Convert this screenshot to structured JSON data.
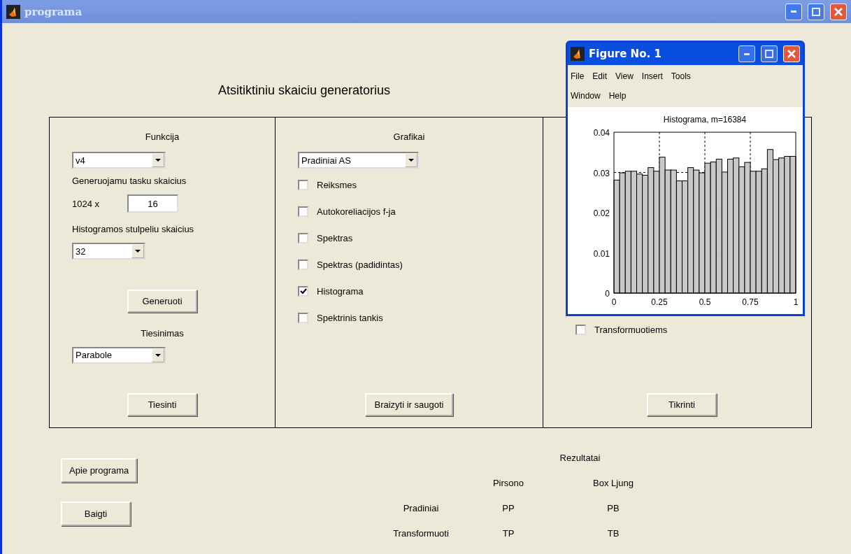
{
  "window": {
    "title": "programa"
  },
  "heading": "Atsitiktiniu skaiciu generatorius",
  "panels": [
    {
      "title": "Funkcija",
      "items": [
        {
          "kind": "dropdown",
          "value": "v4"
        },
        {
          "kind": "label",
          "text": "Generuojamu tasku skaicius"
        },
        {
          "kind": "multiplier",
          "text": "1024 x",
          "value": "16"
        },
        {
          "kind": "label",
          "text": "Histogramos stulpeliu skaicius"
        },
        {
          "kind": "dropdown",
          "value": "32"
        },
        {
          "kind": "button",
          "text": "Generuoti"
        },
        {
          "kind": "heading",
          "text": "Tiesinimas"
        },
        {
          "kind": "dropdown",
          "value": "Parabole"
        },
        {
          "kind": "button",
          "text": "Tiesinti"
        }
      ]
    },
    {
      "title": "Grafikai",
      "items": [
        {
          "kind": "dropdown",
          "value": "Pradiniai AS"
        },
        {
          "kind": "checkbox",
          "text": "Reiksmes",
          "checked": false
        },
        {
          "kind": "checkbox",
          "text": "Autokoreliacijos f-ja",
          "checked": false
        },
        {
          "kind": "checkbox",
          "text": "Spektras",
          "checked": false
        },
        {
          "kind": "checkbox",
          "text": "Spektras (padidintas)",
          "checked": false
        },
        {
          "kind": "checkbox",
          "text": "Histograma",
          "checked": true
        },
        {
          "kind": "checkbox",
          "text": "Spektrinis tankis",
          "checked": false
        },
        {
          "kind": "button",
          "text": "Braizyti ir saugoti"
        }
      ]
    },
    {
      "items": [
        {
          "kind": "checkbox",
          "text": "Transformuotiems",
          "checked": false
        },
        {
          "kind": "button",
          "text": "Tikrinti"
        }
      ]
    }
  ],
  "side_buttons": [
    "Apie programa",
    "Baigti"
  ],
  "results": {
    "title": "Rezultatai",
    "columns": [
      "Pirsono",
      "Box Ljung"
    ],
    "rows": [
      {
        "label": "Pradiniai",
        "cells": [
          "PP",
          "PB"
        ]
      },
      {
        "label": "Transformuoti",
        "cells": [
          "TP",
          "TB"
        ]
      }
    ]
  },
  "figure": {
    "title": "Figure No. 1",
    "menu": [
      [
        "File",
        "Edit",
        "View",
        "Insert",
        "Tools"
      ],
      [
        "Window",
        "Help"
      ]
    ],
    "chart_data": {
      "type": "bar",
      "title": "Histograma, m=16384",
      "xlim": [
        0,
        1
      ],
      "ylim": [
        0,
        0.04
      ],
      "xticks": [
        0,
        0.25,
        0.5,
        0.75,
        1
      ],
      "yticks": [
        0,
        0.01,
        0.02,
        0.03,
        0.04
      ],
      "grid": true,
      "x": [
        0.015625,
        0.046875,
        0.078125,
        0.109375,
        0.140625,
        0.171875,
        0.203125,
        0.234375,
        0.265625,
        0.296875,
        0.328125,
        0.359375,
        0.390625,
        0.421875,
        0.453125,
        0.484375,
        0.515625,
        0.546875,
        0.578125,
        0.609375,
        0.640625,
        0.671875,
        0.703125,
        0.734375,
        0.765625,
        0.796875,
        0.828125,
        0.859375,
        0.890625,
        0.921875,
        0.953125,
        0.984375
      ],
      "series": [
        {
          "color": "#c8c8c8",
          "values": [
            0.0281,
            0.0299,
            0.0303,
            0.0303,
            0.0296,
            0.0293,
            0.0312,
            0.0303,
            0.0338,
            0.0306,
            0.0306,
            0.0279,
            0.0279,
            0.0312,
            0.0306,
            0.0299,
            0.0323,
            0.0326,
            0.0333,
            0.0301,
            0.0333,
            0.0336,
            0.0314,
            0.0325,
            0.0303,
            0.0303,
            0.0309,
            0.0357,
            0.0332,
            0.0336,
            0.034,
            0.034
          ]
        }
      ]
    }
  }
}
